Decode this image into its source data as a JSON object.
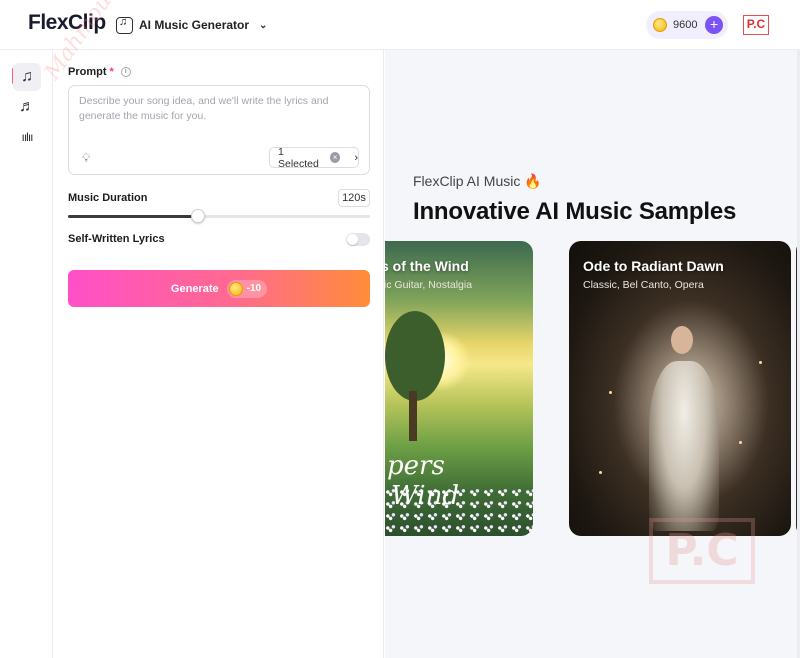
{
  "app": {
    "logo": "FlexClip",
    "tool_selector": "AI Music Generator",
    "credits": "9600",
    "brand_badge": "P.C"
  },
  "rail": {
    "items": [
      "ai-music-text",
      "music-note",
      "sound-waves"
    ]
  },
  "form": {
    "prompt_label": "Prompt",
    "required_mark": "*",
    "prompt_placeholder": "Describe your song idea, and we'll write the lyrics and generate the music for you.",
    "selected_label": "1 Selected",
    "duration_label": "Music Duration",
    "duration_value": "120s",
    "duration_fraction": 0.43,
    "lyrics_label": "Self-Written Lyrics",
    "lyrics_enabled": false,
    "generate_label": "Generate",
    "generate_cost": "-10"
  },
  "watermark_text": "Mahmoud PC",
  "showcase": {
    "subtitle": "FlexClip AI Music 🔥",
    "title": "Innovative AI Music Samples",
    "cards": [
      {
        "title": "s of the Wind",
        "tags": "tic Guitar, Nostalgia",
        "art_text_1": "pers",
        "art_text_2": "Wind"
      },
      {
        "title": "Ode to Radiant Dawn",
        "tags": "Classic, Bel Canto, Opera"
      }
    ],
    "stamp": "P.C"
  },
  "colors": {
    "accent_purple": "#7b53f5",
    "generate_gradient_start": "#ff4fc8",
    "generate_gradient_end": "#ff8c3a",
    "required": "#ff3b5c"
  }
}
